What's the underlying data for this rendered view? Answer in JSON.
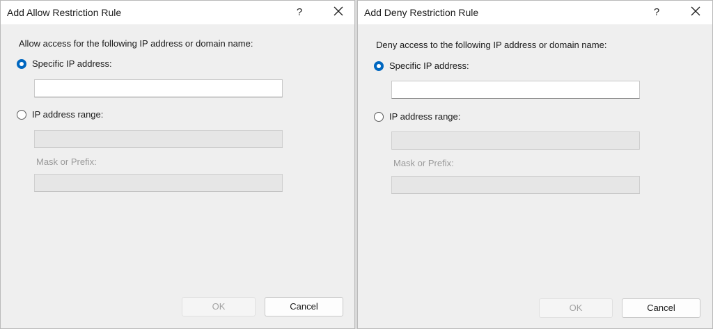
{
  "allow_dialog": {
    "title": "Add Allow Restriction Rule",
    "help_label": "?",
    "prompt": "Allow access for the following IP address or domain name:",
    "specific_ip_label": "Specific IP address:",
    "specific_ip_value": "",
    "ip_range_label": "IP address range:",
    "ip_range_value": "",
    "mask_label": "Mask or Prefix:",
    "mask_value": "",
    "ok_label": "OK",
    "cancel_label": "Cancel"
  },
  "deny_dialog": {
    "title": "Add Deny Restriction Rule",
    "help_label": "?",
    "prompt": "Deny access to the following IP address or domain name:",
    "specific_ip_label": "Specific IP address:",
    "specific_ip_value": "",
    "ip_range_label": "IP address range:",
    "ip_range_value": "",
    "mask_label": "Mask or Prefix:",
    "mask_value": "",
    "ok_label": "OK",
    "cancel_label": "Cancel"
  },
  "colors": {
    "accent": "#0067c0",
    "dialog_bg": "#efefef",
    "titlebar_bg": "#ffffff",
    "disabled_text": "#9a9a9a"
  },
  "icons": {
    "close": "close-icon",
    "radio_selected": "radio-checked",
    "radio_unselected": "radio-unchecked"
  }
}
